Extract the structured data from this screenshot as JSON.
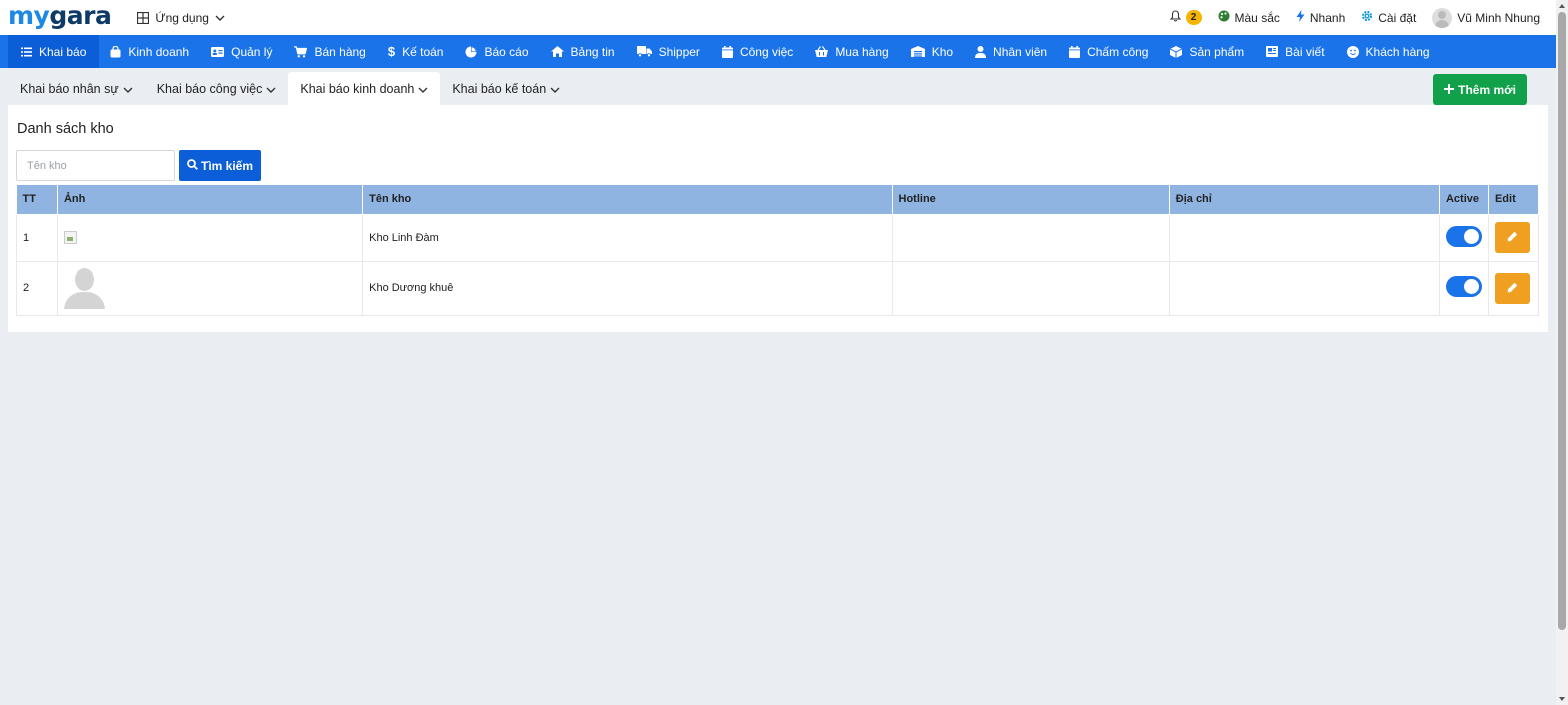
{
  "brand": {
    "logo_part1": "my",
    "logo_part2": "gara"
  },
  "topbar": {
    "apps_label": "Ứng dụng",
    "notifications_count": "2",
    "color_label": "Màu sắc",
    "quick_label": "Nhanh",
    "settings_label": "Cài đặt",
    "user_name": "Vũ Minh Nhung"
  },
  "mainnav": {
    "items": [
      {
        "label": "Khai báo",
        "icon": "list-icon"
      },
      {
        "label": "Kinh doanh",
        "icon": "shopping-bag-icon"
      },
      {
        "label": "Quản lý",
        "icon": "id-card-icon"
      },
      {
        "label": "Bán hàng",
        "icon": "cart-icon"
      },
      {
        "label": "Kế toán",
        "icon": "dollar-icon"
      },
      {
        "label": "Báo cáo",
        "icon": "pie-chart-icon"
      },
      {
        "label": "Bảng tin",
        "icon": "home-icon"
      },
      {
        "label": "Shipper",
        "icon": "truck-icon"
      },
      {
        "label": "Công việc",
        "icon": "calendar-icon"
      },
      {
        "label": "Mua hàng",
        "icon": "basket-icon"
      },
      {
        "label": "Kho",
        "icon": "warehouse-icon"
      },
      {
        "label": "Nhân viên",
        "icon": "user-icon"
      },
      {
        "label": "Chấm công",
        "icon": "calendar-check-icon"
      },
      {
        "label": "Sản phẩm",
        "icon": "box-icon"
      },
      {
        "label": "Bài viết",
        "icon": "newspaper-icon"
      },
      {
        "label": "Khách hàng",
        "icon": "smile-icon"
      }
    ]
  },
  "subtabs": {
    "items": [
      {
        "label": "Khai báo nhân sự"
      },
      {
        "label": "Khai báo công việc"
      },
      {
        "label": "Khai báo kinh doanh"
      },
      {
        "label": "Khai báo kế toán"
      }
    ],
    "add_button": "Thêm mới"
  },
  "panel": {
    "title": "Danh sách kho",
    "search_placeholder": "Tên kho",
    "search_button": "Tìm kiếm",
    "columns": [
      "TT",
      "Ảnh",
      "Tên kho",
      "Hotline",
      "Địa chỉ",
      "Active",
      "Edit"
    ],
    "rows": [
      {
        "tt": "1",
        "name": "Kho Linh Đàm",
        "hotline": "",
        "address": "",
        "active": true
      },
      {
        "tt": "2",
        "name": "Kho Dương khuê",
        "hotline": "",
        "address": "",
        "active": true
      }
    ]
  },
  "colors": {
    "nav_blue": "#1a73e8",
    "nav_active": "#0b5ed7",
    "header_row": "#8fb4e2",
    "add_green": "#11a14a",
    "edit_orange": "#f0a020",
    "badge_yellow": "#f5b400"
  }
}
